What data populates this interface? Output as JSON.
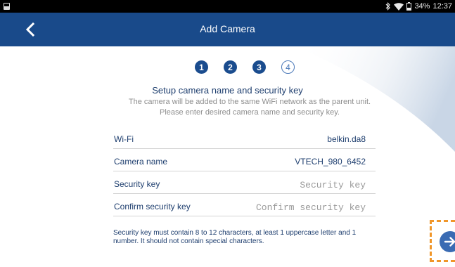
{
  "status_bar": {
    "battery_percent_label": "34%",
    "time": "12:37",
    "icons": [
      "notification-icon",
      "bluetooth-icon",
      "wifi-icon",
      "battery-icon"
    ]
  },
  "app_bar": {
    "title": "Add Camera",
    "back_icon": "chevron-left-icon",
    "background_color": "#194a8a"
  },
  "stepper": {
    "steps": [
      {
        "label": "1",
        "state": "done"
      },
      {
        "label": "2",
        "state": "done"
      },
      {
        "label": "3",
        "state": "done"
      },
      {
        "label": "4",
        "state": "current"
      }
    ]
  },
  "heading": "Setup camera name and security key",
  "description_line1": "The camera will be added to the same WiFi network as the parent unit.",
  "description_line2": "Please enter desired camera name and security key.",
  "form": {
    "wifi": {
      "label": "Wi-Fi",
      "value": "belkin.da8"
    },
    "camera_name": {
      "label": "Camera name",
      "value": "VTECH_980_6452"
    },
    "security_key": {
      "label": "Security key",
      "value": "",
      "placeholder": "Security key"
    },
    "confirm_security_key": {
      "label": "Confirm security key",
      "value": "",
      "placeholder": "Confirm security key"
    }
  },
  "hint": "Security key must contain 8 to 12 characters, at least 1 uppercase letter and 1 number. It should not contain special characters.",
  "next_button": {
    "icon": "arrow-right-icon",
    "accent_color": "#3a6bb3",
    "highlight_color": "#f0962a"
  }
}
